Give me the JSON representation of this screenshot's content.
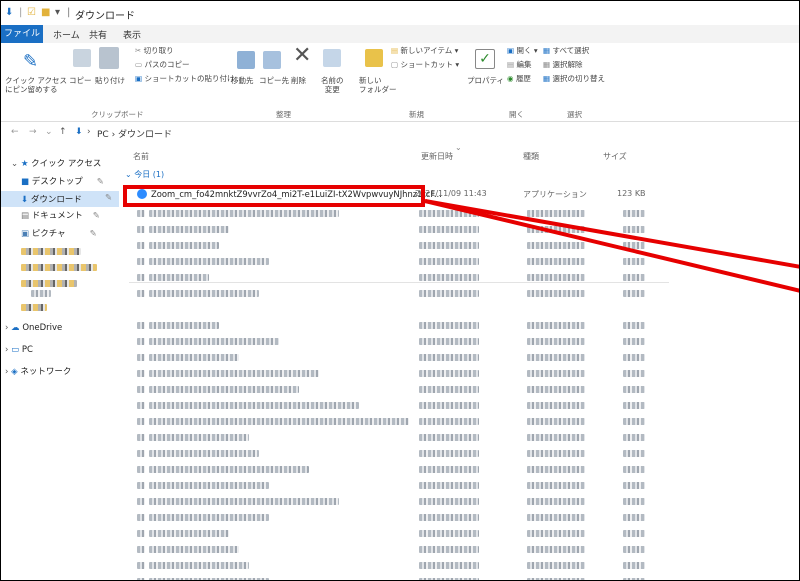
{
  "window": {
    "title": "ダウンロード"
  },
  "tabs": [
    "ファイル",
    "ホーム",
    "共有",
    "表示"
  ],
  "ribbon": {
    "pin": "クイック アクセス\nにピン留めする",
    "copy": "コピー",
    "paste": "貼り付け",
    "cut": "切り取り",
    "copy_path": "パスのコピー",
    "paste_shortcut": "ショートカットの貼り付け",
    "move_to": "移動先",
    "copy_to": "コピー先",
    "delete": "削除",
    "rename": "名前の\n変更",
    "new_folder": "新しい\nフォルダー",
    "new_item": "新しいアイテム ▾",
    "shortcut": "ショートカット ▾",
    "properties": "プロパティ",
    "open": "開く ▾",
    "edit": "編集",
    "history": "履歴",
    "select_all": "すべて選択",
    "select_none": "選択解除",
    "invert": "選択の切り替え",
    "groups": [
      "クリップボード",
      "整理",
      "新規",
      "開く",
      "選択"
    ]
  },
  "address": {
    "path": "PC › ダウンロード"
  },
  "sidebar": [
    "クイック アクセス",
    "デスクトップ",
    "ダウンロード",
    "ドキュメント",
    "ピクチャ",
    "OneDrive",
    "PC",
    "ネットワーク"
  ],
  "columns": {
    "name": "名前",
    "date": "更新日時",
    "type": "種類",
    "size": "サイズ"
  },
  "group_today": "今日 (1)",
  "file": {
    "name": "Zoom_cm_fo42mnktZ9vvrZo4_mi2T-e1LuiZI-tX2WvpwvuyNJhnz1tcF...",
    "date": "2021/11/09 11:43",
    "type": "アプリケーション",
    "size": "123 KB"
  },
  "colors": {
    "accent": "#1a6fc4",
    "highlight": "#e60000"
  }
}
